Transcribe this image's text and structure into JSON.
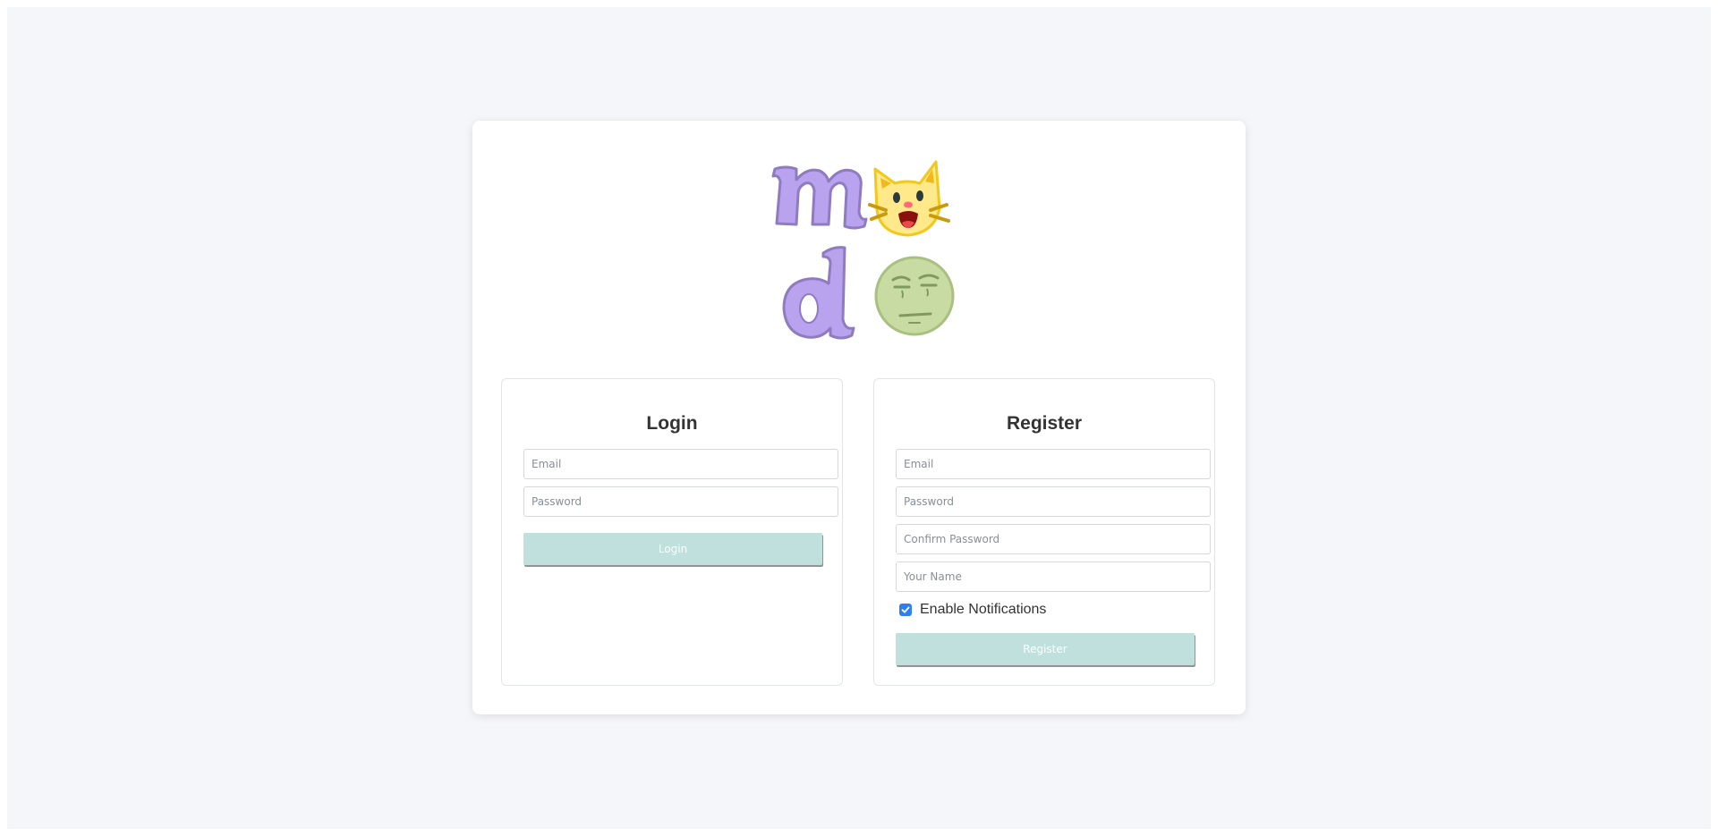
{
  "logo": {
    "letters": [
      "m",
      "d"
    ],
    "icons": [
      "cat-face-icon",
      "skeptical-face-icon"
    ],
    "colors": {
      "letter_fill": "#b9a2ee",
      "letter_stroke": "#8f7bbf",
      "cat_fill": "#ffe98a",
      "cat_stroke": "#f2c81b",
      "face_fill": "#c8dba2",
      "face_stroke": "#a8c080"
    }
  },
  "login": {
    "title": "Login",
    "email_placeholder": "Email",
    "password_placeholder": "Password",
    "button_label": "Login"
  },
  "register": {
    "title": "Register",
    "email_placeholder": "Email",
    "password_placeholder": "Password",
    "confirm_password_placeholder": "Confirm Password",
    "name_placeholder": "Your Name",
    "notifications_label": "Enable Notifications",
    "notifications_checked": true,
    "button_label": "Register"
  },
  "colors": {
    "page_background": "#f5f6f9",
    "button_background": "#bfe0dc",
    "checkbox_accent": "#2f7ff0"
  }
}
